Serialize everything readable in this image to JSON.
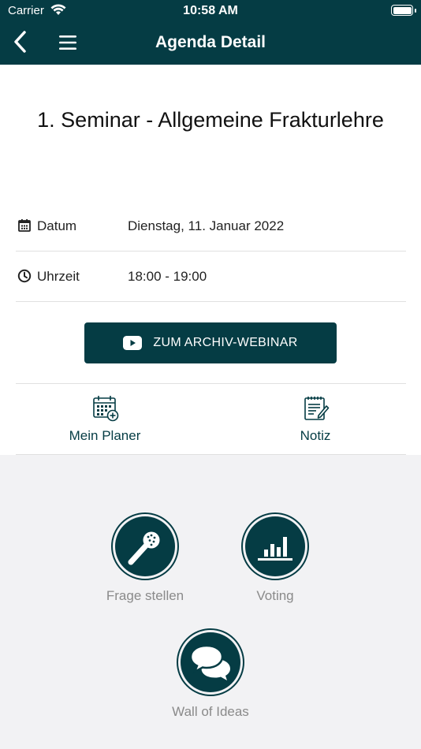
{
  "status_bar": {
    "carrier": "Carrier",
    "time": "10:58 AM"
  },
  "nav": {
    "title": "Agenda Detail"
  },
  "seminar": {
    "title": "1. Seminar - Allgemeine Frakturlehre"
  },
  "details": {
    "date_label": "Datum",
    "date_value": "Dienstag, 11. Januar 2022",
    "time_label": "Uhrzeit",
    "time_value": "18:00 - 19:00"
  },
  "webinar_button": {
    "label": "ZUM ARCHIV-WEBINAR"
  },
  "actions": {
    "planner_label": "Mein Planer",
    "note_label": "Notiz"
  },
  "interactive": {
    "ask_label": "Frage stellen",
    "voting_label": "Voting",
    "wall_label": "Wall of Ideas"
  },
  "colors": {
    "primary": "#053c44",
    "background": "#f2f2f4",
    "muted_text": "#8a8a8a"
  }
}
